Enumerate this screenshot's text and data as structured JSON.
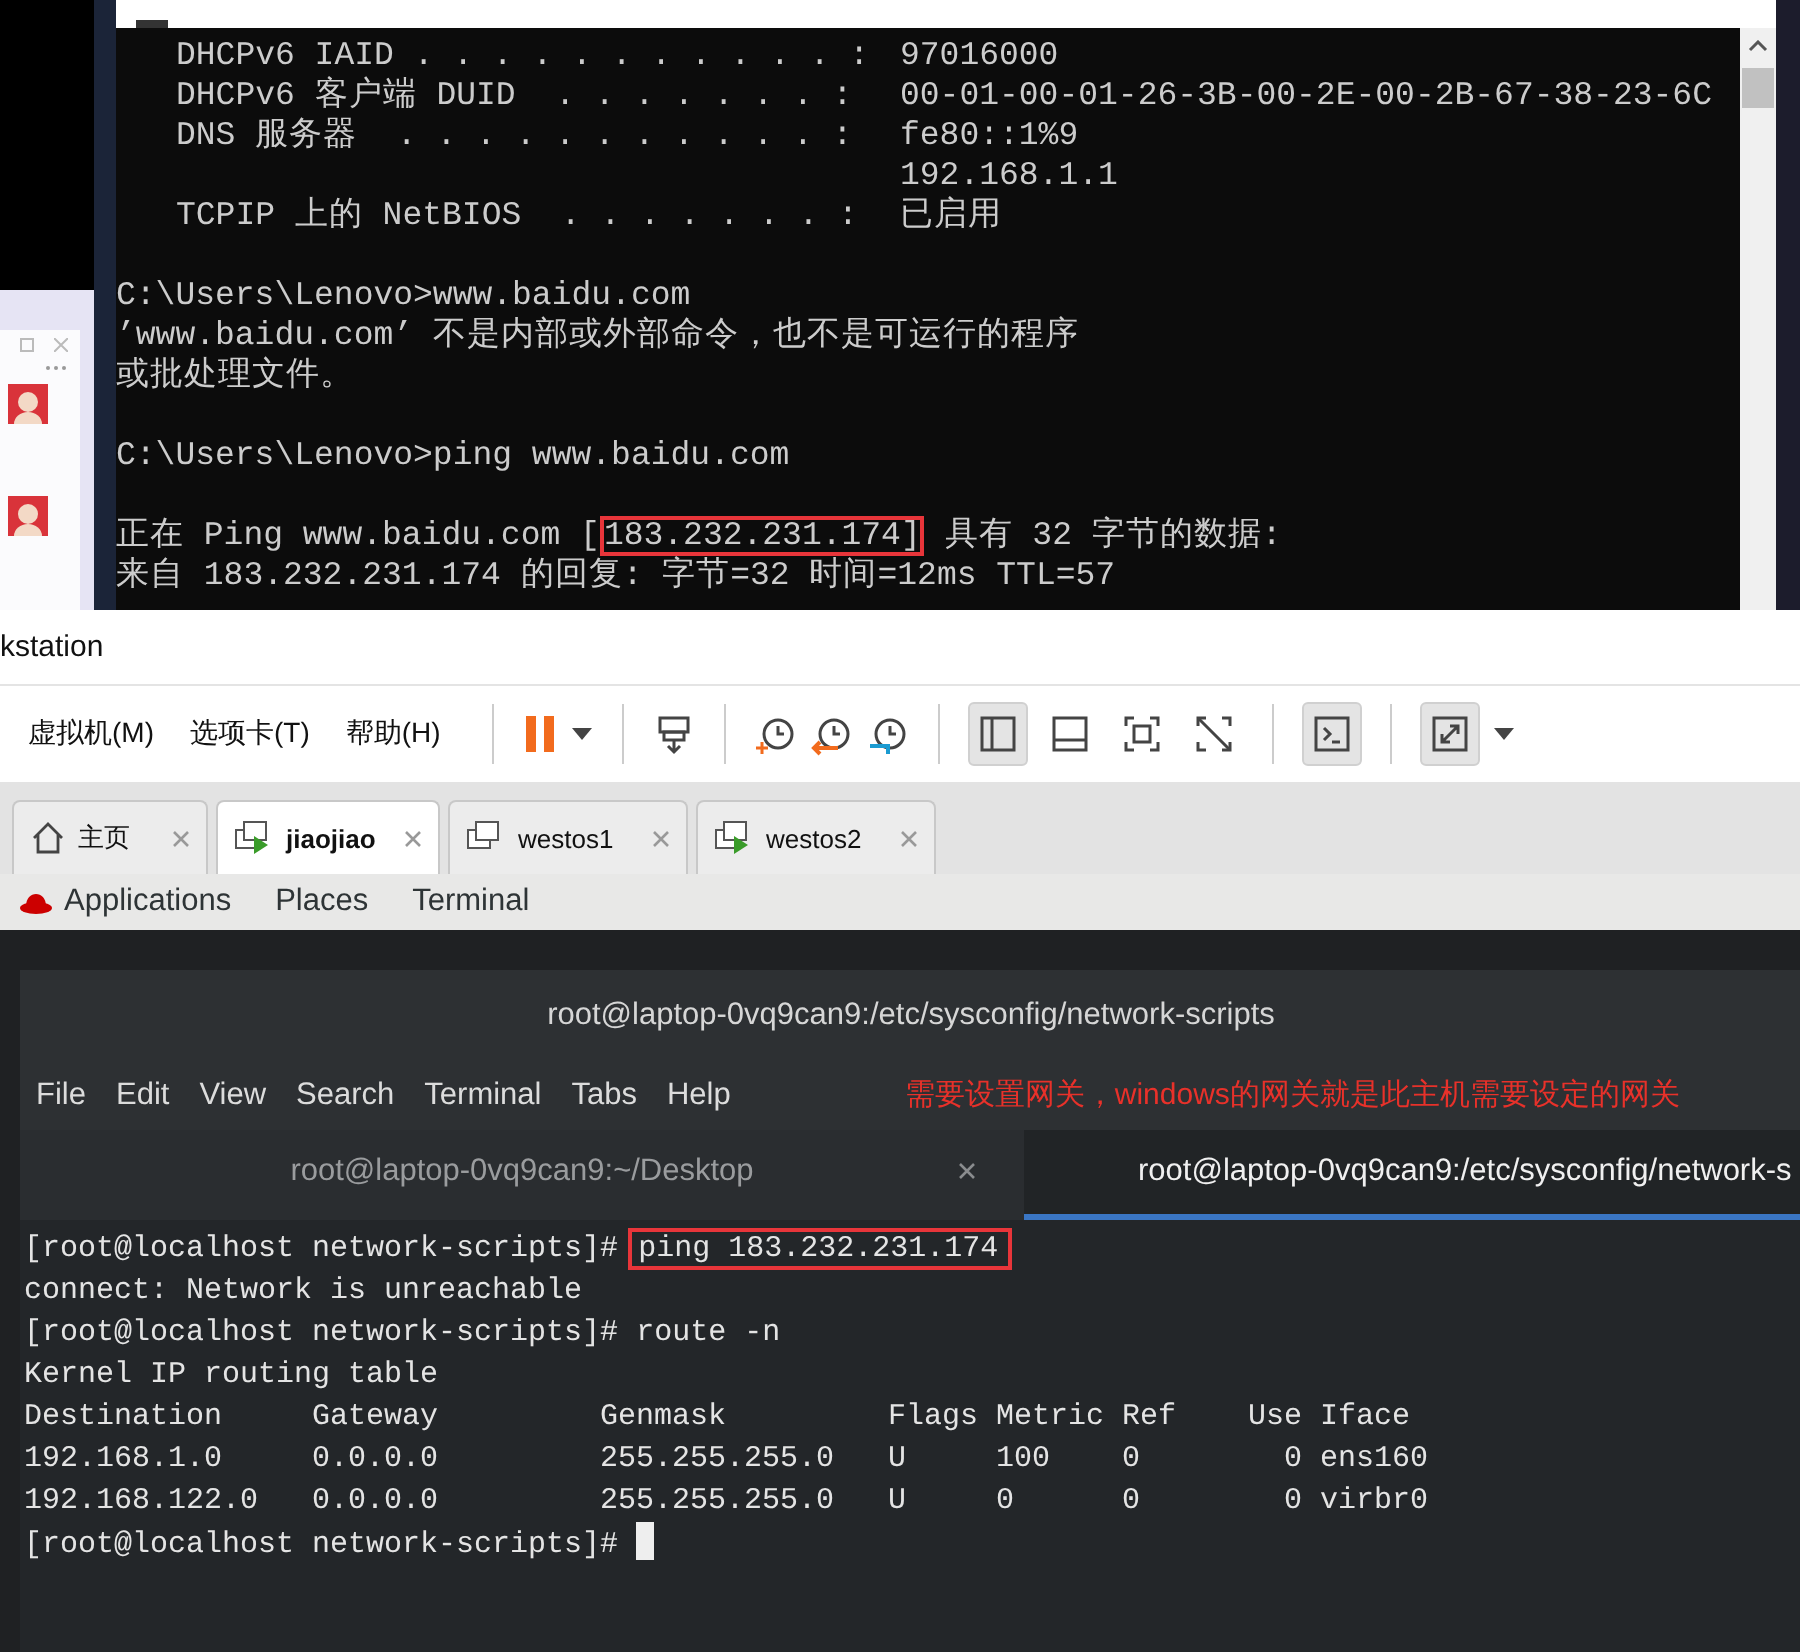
{
  "cmd": {
    "entries": [
      {
        "label": "DHCPv6 IAID . . . . . . . . . . . :",
        "values": [
          "97016000"
        ]
      },
      {
        "label": "DHCPv6 客户端 DUID  . . . . . . . :",
        "values": [
          "00-01-00-01-26-3B-00-2E-00-2B-67-38-23-6C"
        ]
      },
      {
        "label": "DNS 服务器  . . . . . . . . . . . :",
        "values": [
          "fe80::1%9",
          "192.168.1.1"
        ]
      },
      {
        "label": "TCPIP 上的 NetBIOS  . . . . . . . :",
        "values": [
          "已启用"
        ]
      }
    ],
    "session": [
      {
        "lines": [
          "C:\\Users\\Lenovo>www.baidu.com",
          "’www.baidu.com’ 不是内部或外部命令，也不是可运行的程序",
          "或批处理文件。"
        ]
      },
      {
        "lines": [
          "C:\\Users\\Lenovo>ping www.baidu.com"
        ]
      }
    ],
    "ping": {
      "before": "正在 Ping www.baidu.com [",
      "highlight": "183.232.231.174]",
      "after": " 具有 32 字节的数据:",
      "replies": [
        "来自 183.232.231.174 的回复: 字节=32 时间=12ms TTL=57"
      ]
    }
  },
  "vmware": {
    "title": "kstation",
    "menu": [
      "虚拟机(M)",
      "选项卡(T)",
      "帮助(H)"
    ],
    "toggles": {
      "sidebar": true,
      "thumbnail": false,
      "fullscreen": false,
      "unity": false,
      "console": true,
      "stretch": true
    },
    "tabs": [
      {
        "label": "主页",
        "kind": "home",
        "selected": false
      },
      {
        "label": "jiaojiao",
        "kind": "vm",
        "running": true,
        "selected": true
      },
      {
        "label": "westos1",
        "kind": "vm",
        "running": false,
        "selected": false
      },
      {
        "label": "westos2",
        "kind": "vm",
        "running": true,
        "selected": false
      }
    ]
  },
  "guest": {
    "top_bar": [
      "Applications",
      "Places",
      "Terminal"
    ],
    "terminal": {
      "title": "root@laptop-0vq9can9:/etc/sysconfig/network-scripts",
      "menu": [
        "File",
        "Edit",
        "View",
        "Search",
        "Terminal",
        "Tabs",
        "Help"
      ],
      "annotation": "需要设置网关，windows的网关就是此主机需要设定的网关",
      "tabs": [
        {
          "label": "root@laptop-0vq9can9:~/Desktop",
          "selected": false
        },
        {
          "label": "root@laptop-0vq9can9:/etc/sysconfig/network-s",
          "selected": true
        }
      ],
      "lines": [
        {
          "kind": "command",
          "prompt": "[root@localhost network-scripts]#",
          "command": "ping 183.232.231.174",
          "highlight": true
        },
        {
          "kind": "output",
          "text": "connect: Network is unreachable"
        },
        {
          "kind": "command",
          "prompt": "[root@localhost network-scripts]#",
          "command": "route -n",
          "highlight": false
        },
        {
          "kind": "output",
          "text": "Kernel IP routing table"
        },
        {
          "kind": "table",
          "columns": [
            "Destination",
            "Gateway",
            "Genmask",
            "Flags",
            "Metric",
            "Ref",
            "Use",
            "Iface"
          ],
          "rows": [
            [
              "192.168.1.0",
              "0.0.0.0",
              "255.255.255.0",
              "U",
              "100",
              "0",
              "0",
              "ens160"
            ],
            [
              "192.168.122.0",
              "0.0.0.0",
              "255.255.255.0",
              "U",
              "0",
              "0",
              "0",
              "virbr0"
            ]
          ]
        },
        {
          "kind": "cursor",
          "prompt": "[root@localhost network-scripts]#"
        }
      ]
    }
  }
}
